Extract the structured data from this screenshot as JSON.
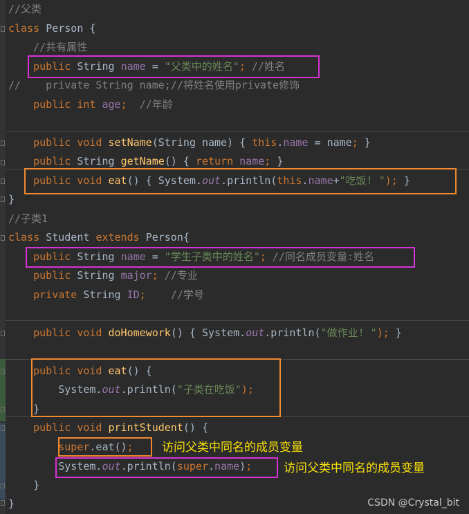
{
  "code_lines": [
    [
      [
        "//父类",
        "cm"
      ]
    ],
    [
      [
        "class ",
        "kw"
      ],
      [
        "Person {",
        "pl"
      ]
    ],
    [
      [
        "    //共有属性",
        "cm"
      ]
    ],
    [
      [
        "    ",
        "pl"
      ],
      [
        "public ",
        "kw"
      ],
      [
        "String ",
        "pl"
      ],
      [
        "name",
        "fd"
      ],
      [
        " = ",
        "pl"
      ],
      [
        "\"父类中的姓名\"",
        "st"
      ],
      [
        "; ",
        "kw"
      ],
      [
        "//姓名",
        "cm"
      ]
    ],
    [
      [
        "//    private String name;//将姓名使用private修饰",
        "cm"
      ]
    ],
    [
      [
        "    ",
        "pl"
      ],
      [
        "public ",
        "kw"
      ],
      [
        "int ",
        "kw"
      ],
      [
        "age",
        "fd"
      ],
      [
        ";  ",
        "kw"
      ],
      [
        "//年龄",
        "cm"
      ]
    ],
    [],
    [
      [
        "    ",
        "pl"
      ],
      [
        "public ",
        "kw"
      ],
      [
        "void ",
        "kw"
      ],
      [
        "setName",
        "fn"
      ],
      [
        "(String name) { ",
        "pl"
      ],
      [
        "this",
        "kw"
      ],
      [
        ".",
        "pl"
      ],
      [
        "name",
        "fd"
      ],
      [
        " = name",
        "pl"
      ],
      [
        ";",
        "kw"
      ],
      [
        " }",
        "pl"
      ]
    ],
    [
      [
        "    ",
        "pl"
      ],
      [
        "public ",
        "kw"
      ],
      [
        "String ",
        "pl"
      ],
      [
        "getName",
        "fn"
      ],
      [
        "() { ",
        "pl"
      ],
      [
        "return ",
        "kw"
      ],
      [
        "name",
        "fd"
      ],
      [
        ";",
        "kw"
      ],
      [
        " }",
        "pl"
      ]
    ],
    [
      [
        "    ",
        "pl"
      ],
      [
        "public ",
        "kw"
      ],
      [
        "void ",
        "kw"
      ],
      [
        "eat",
        "fn"
      ],
      [
        "() { System.",
        "pl"
      ],
      [
        "out",
        "sx"
      ],
      [
        ".println(",
        "pl"
      ],
      [
        "this",
        "kw"
      ],
      [
        ".",
        "pl"
      ],
      [
        "name",
        "fd"
      ],
      [
        "+",
        "pl"
      ],
      [
        "\"吃饭! \"",
        "st"
      ],
      [
        ");",
        "kw"
      ],
      [
        " }",
        "pl"
      ]
    ],
    [
      [
        "}",
        "pl"
      ]
    ],
    [
      [
        "//子类1",
        "cm"
      ]
    ],
    [
      [
        "class ",
        "kw"
      ],
      [
        "Student ",
        "pl"
      ],
      [
        "extends ",
        "kw"
      ],
      [
        "Person{",
        "pl"
      ]
    ],
    [
      [
        "    ",
        "pl"
      ],
      [
        "public ",
        "kw"
      ],
      [
        "String ",
        "pl"
      ],
      [
        "name",
        "fd"
      ],
      [
        " = ",
        "pl"
      ],
      [
        "\"学生子类中的姓名\"",
        "st"
      ],
      [
        "; ",
        "kw"
      ],
      [
        "//同名成员变量:姓名",
        "cm"
      ]
    ],
    [
      [
        "    ",
        "pl"
      ],
      [
        "public ",
        "kw"
      ],
      [
        "String ",
        "pl"
      ],
      [
        "major",
        "fd"
      ],
      [
        "; ",
        "kw"
      ],
      [
        "//专业",
        "cm"
      ]
    ],
    [
      [
        "    ",
        "pl"
      ],
      [
        "private ",
        "kw"
      ],
      [
        "String ",
        "pl"
      ],
      [
        "ID",
        "fd"
      ],
      [
        ";    ",
        "kw"
      ],
      [
        "//学号",
        "cm"
      ]
    ],
    [],
    [
      [
        "    ",
        "pl"
      ],
      [
        "public ",
        "kw"
      ],
      [
        "void ",
        "kw"
      ],
      [
        "doHomework",
        "fn"
      ],
      [
        "() { System.",
        "pl"
      ],
      [
        "out",
        "sx"
      ],
      [
        ".println(",
        "pl"
      ],
      [
        "\"做作业! \"",
        "st"
      ],
      [
        ");",
        "kw"
      ],
      [
        " }",
        "pl"
      ]
    ],
    [],
    [
      [
        "    ",
        "pl"
      ],
      [
        "public ",
        "kw"
      ],
      [
        "void ",
        "kw"
      ],
      [
        "eat",
        "fn"
      ],
      [
        "() {",
        "pl"
      ]
    ],
    [
      [
        "        System.",
        "pl"
      ],
      [
        "out",
        "sx"
      ],
      [
        ".println(",
        "pl"
      ],
      [
        "\"子类在吃饭\"",
        "st"
      ],
      [
        ");",
        "kw"
      ]
    ],
    [
      [
        "    }",
        "pl"
      ]
    ],
    [
      [
        "    ",
        "pl"
      ],
      [
        "public ",
        "kw"
      ],
      [
        "void ",
        "kw"
      ],
      [
        "printStudent",
        "fn"
      ],
      [
        "() {",
        "pl"
      ]
    ],
    [
      [
        "        ",
        "pl"
      ],
      [
        "super",
        "kw"
      ],
      [
        ".eat()",
        "pl"
      ],
      [
        ";",
        "kw"
      ]
    ],
    [
      [
        "        System.",
        "pl"
      ],
      [
        "out",
        "sx"
      ],
      [
        ".println(",
        "pl"
      ],
      [
        "super",
        "kw"
      ],
      [
        ".",
        "pl"
      ],
      [
        "name",
        "fd"
      ],
      [
        ")",
        "pl"
      ],
      [
        ";",
        "kw"
      ]
    ],
    [
      [
        "    }",
        "pl"
      ]
    ],
    [
      [
        "}",
        "pl"
      ]
    ]
  ],
  "annotations": {
    "super_eat": "访问父类中同名的成员变量",
    "super_name": "访问父类中同名的成员变量"
  },
  "watermark": "CSDN @Crystal_bit",
  "colors": {
    "background": "#2b2b2b",
    "keyword": "#cc7832",
    "string": "#6a8759",
    "comment": "#808080",
    "field": "#9876aa",
    "method": "#ffc66d",
    "text": "#a9b7c6",
    "box_magenta": "#d633d6",
    "box_orange": "#f0892f",
    "annotation_text": "#f7e200"
  }
}
